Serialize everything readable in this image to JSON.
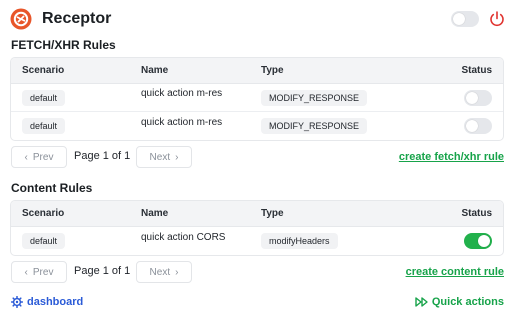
{
  "app": {
    "title": "Receptor",
    "master_enabled": false
  },
  "columns": {
    "scenario": "Scenario",
    "name": "Name",
    "type": "Type",
    "status": "Status"
  },
  "fetch": {
    "title": "FETCH/XHR Rules",
    "rows": [
      {
        "scenario": "default",
        "name": "quick action m-res",
        "type": "MODIFY_RESPONSE",
        "enabled": false
      },
      {
        "scenario": "default",
        "name": "quick action m-res",
        "type": "MODIFY_RESPONSE",
        "enabled": false
      }
    ],
    "pager": {
      "prev": "Prev",
      "page_text": "Page 1 of 1",
      "next": "Next"
    },
    "create_link": "create fetch/xhr rule"
  },
  "content": {
    "title": "Content Rules",
    "rows": [
      {
        "scenario": "default",
        "name": "quick action CORS",
        "type": "modifyHeaders",
        "enabled": true
      }
    ],
    "pager": {
      "prev": "Prev",
      "page_text": "Page 1 of 1",
      "next": "Next"
    },
    "create_link": "create content rule"
  },
  "footer": {
    "dashboard": "dashboard",
    "quick_actions": "Quick actions"
  },
  "colors": {
    "accent_green": "#22b14c",
    "link_blue": "#2b5bd7",
    "power_red": "#e0332f",
    "logo_orange": "#e8562a"
  },
  "icons": {
    "logo": "receptor-logo-icon",
    "power": "power-icon",
    "gear": "gear-icon",
    "play": "double-play-icon"
  }
}
